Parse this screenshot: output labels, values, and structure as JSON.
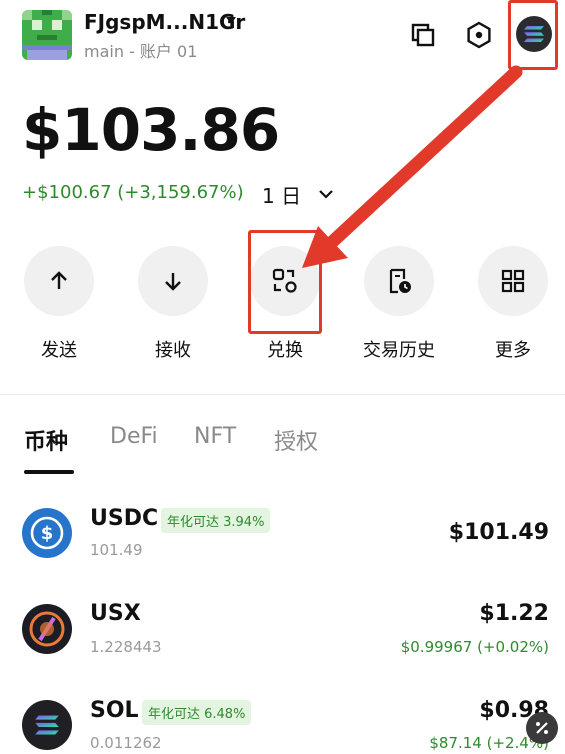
{
  "header": {
    "account_name": "FJgspM...N1Gr",
    "account_sub": "main - 账户 01",
    "icons": [
      "copy-icon",
      "settings-hexagon-icon",
      "solana-network-icon"
    ]
  },
  "balance": {
    "total": "$103.86",
    "change": "+$100.67 (+3,159.67%)",
    "period": "1 日"
  },
  "actions": [
    {
      "label": "发送",
      "icon": "arrow-up-icon"
    },
    {
      "label": "接收",
      "icon": "arrow-down-icon"
    },
    {
      "label": "兑换",
      "icon": "swap-icon"
    },
    {
      "label": "交易历史",
      "icon": "history-icon"
    },
    {
      "label": "更多",
      "icon": "grid-icon"
    }
  ],
  "tabs": [
    {
      "label": "币种",
      "active": true
    },
    {
      "label": "DeFi",
      "active": false
    },
    {
      "label": "NFT",
      "active": false
    },
    {
      "label": "授权",
      "active": false
    }
  ],
  "tokens": [
    {
      "symbol": "USDC",
      "badge": "年化可达 3.94%",
      "amount": "101.49",
      "value": "$101.49",
      "price": ""
    },
    {
      "symbol": "USX",
      "badge": "",
      "amount": "1.228443",
      "value": "$1.22",
      "price": "$0.99967 (+0.02%)"
    },
    {
      "symbol": "SOL",
      "badge": "年化可达 6.48%",
      "amount": "0.011262",
      "value": "$0.98",
      "price": "$87.14 (+2.4%)"
    }
  ],
  "colors": {
    "accent_green": "#2f8a2f",
    "badge_bg": "#e3f5e0",
    "highlight_red": "#e23a2a",
    "usdc_blue": "#2775ca"
  }
}
